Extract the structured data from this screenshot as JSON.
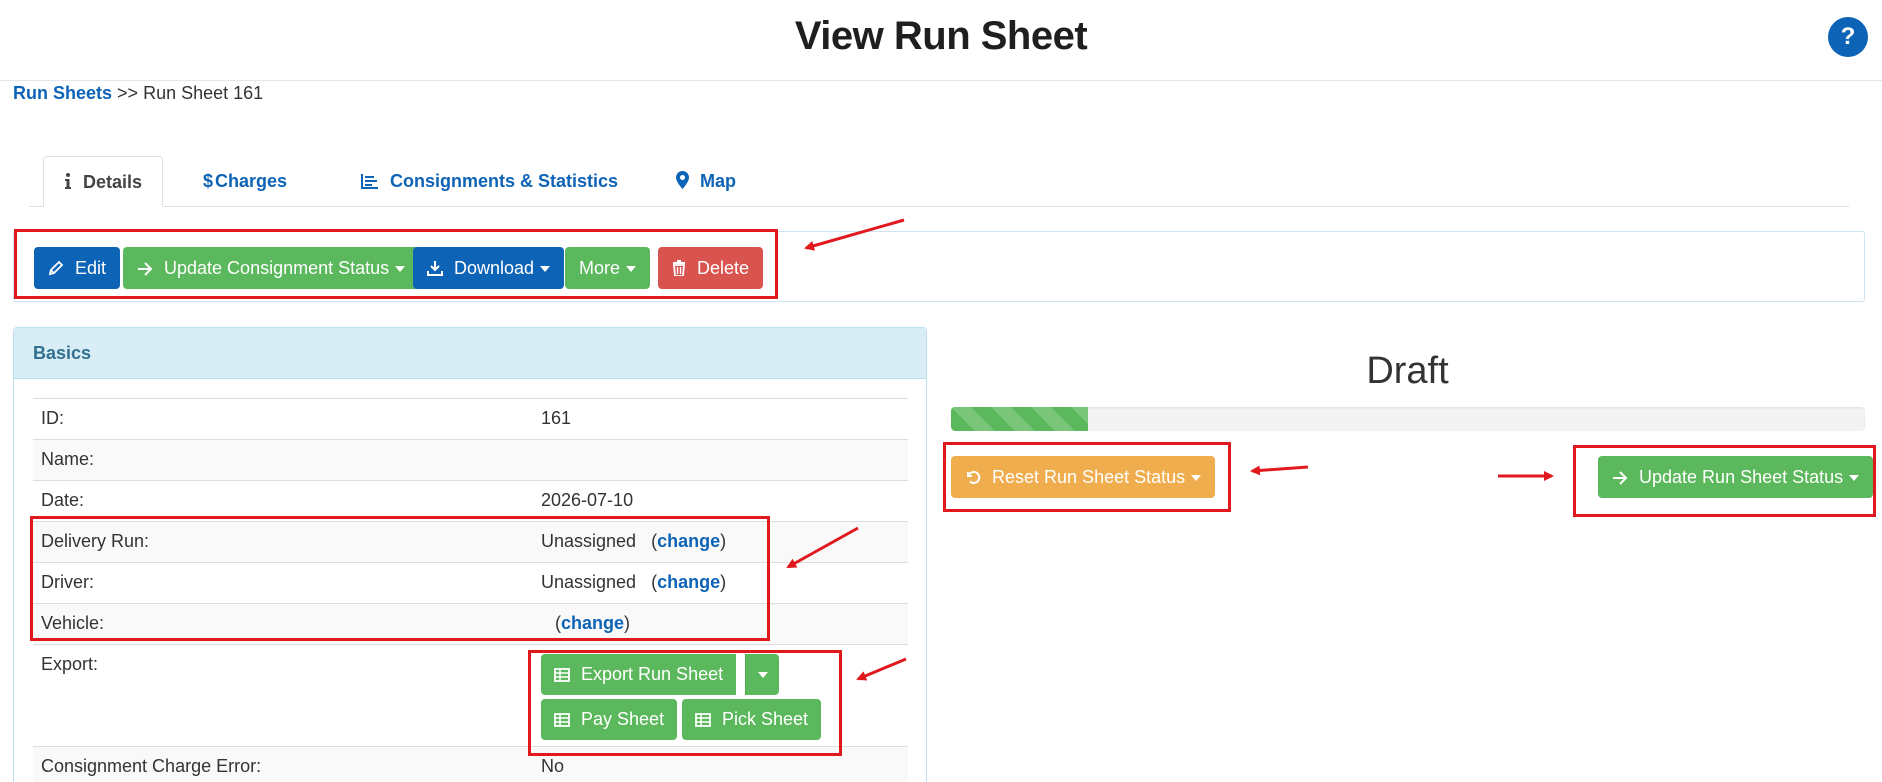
{
  "page": {
    "title": "View Run Sheet",
    "help_label": "?"
  },
  "breadcrumb": {
    "root": "Run Sheets",
    "separator": ">>",
    "current": "Run Sheet 161"
  },
  "tabs": [
    {
      "label": "Details",
      "icon": "info-icon"
    },
    {
      "label": "Charges",
      "icon": "dollar-icon"
    },
    {
      "label": "Consignments & Statistics",
      "icon": "list-chart-icon"
    },
    {
      "label": "Map",
      "icon": "map-marker-icon"
    }
  ],
  "toolbar": {
    "edit": "Edit",
    "update_consignment_status": "Update Consignment Status",
    "download": "Download",
    "more": "More",
    "delete": "Delete"
  },
  "basics": {
    "title": "Basics",
    "rows": [
      {
        "label": "ID:",
        "value": "161"
      },
      {
        "label": "Name:",
        "value": ""
      },
      {
        "label": "Date:",
        "value": "2026-07-10"
      },
      {
        "label": "Delivery Run:",
        "value": "Unassigned",
        "link": "change"
      },
      {
        "label": "Driver:",
        "value": "Unassigned",
        "link": "change"
      },
      {
        "label": "Vehicle:",
        "value": "",
        "link": "change"
      },
      {
        "label": "Export:"
      },
      {
        "label": "Consignment Charge Error:",
        "value": "No"
      }
    ],
    "export": {
      "export_run_sheet": "Export Run Sheet",
      "pay_sheet": "Pay Sheet",
      "pick_sheet": "Pick Sheet"
    }
  },
  "status": {
    "label": "Draft",
    "progress_percent": 15,
    "reset_button": "Reset Run Sheet Status",
    "update_button": "Update Run Sheet Status"
  },
  "colors": {
    "primary": "#0d63b6",
    "success": "#5cb85c",
    "danger": "#d9534f",
    "warning": "#f0ad4e",
    "annotation": "#e0191e"
  }
}
